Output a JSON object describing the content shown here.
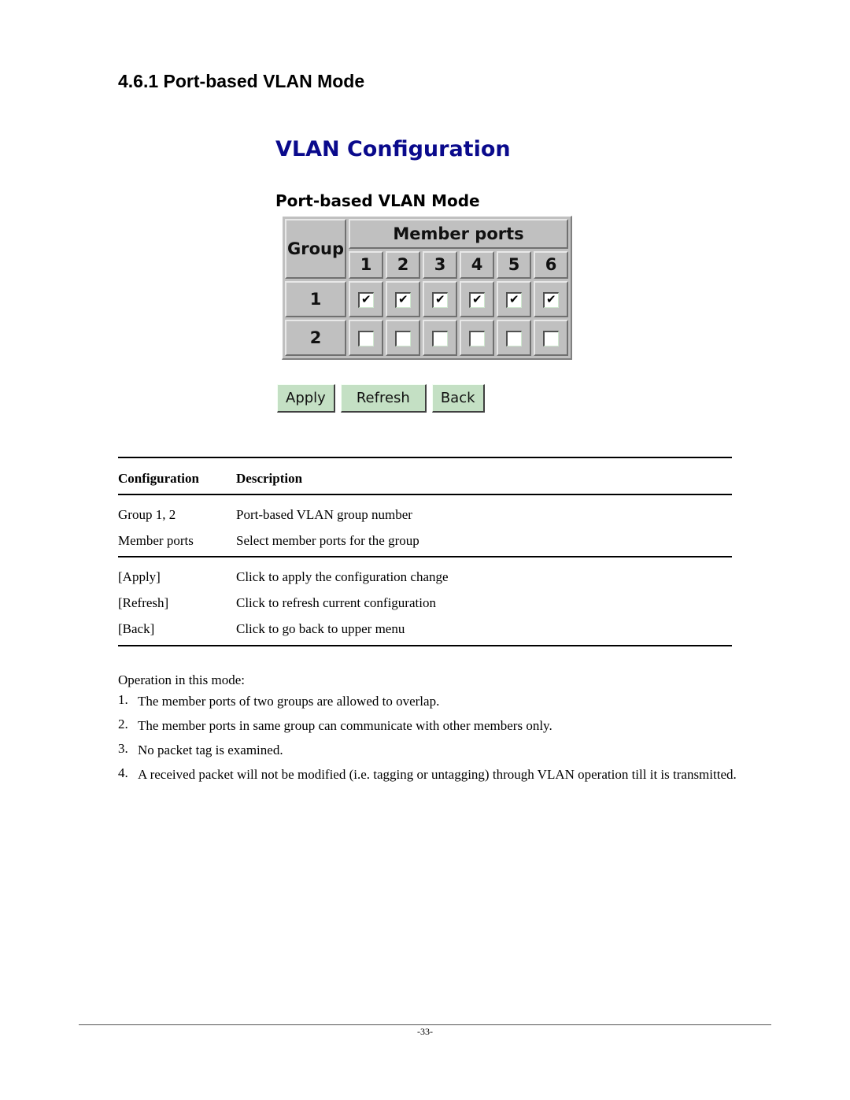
{
  "section": {
    "number": "4.6.1",
    "title": "4.6.1 Port-based VLAN Mode"
  },
  "screenshot": {
    "title": "VLAN Configuration",
    "subtitle": "Port-based VLAN Mode",
    "title_color": "#0a0a8c",
    "table": {
      "group_header": "Group",
      "member_header": "Member ports",
      "ports": [
        "1",
        "2",
        "3",
        "4",
        "5",
        "6"
      ],
      "groups": [
        {
          "label": "1",
          "members": [
            true,
            true,
            true,
            true,
            true,
            true
          ]
        },
        {
          "label": "2",
          "members": [
            false,
            false,
            false,
            false,
            false,
            false
          ]
        }
      ]
    },
    "buttons": {
      "apply": "Apply",
      "refresh": "Refresh",
      "back": "Back"
    },
    "button_color": "#c4e0c4"
  },
  "desc_table": {
    "headers": {
      "config": "Configuration",
      "description": "Description"
    },
    "rows": [
      {
        "config": "Group 1, 2",
        "description": "Port-based VLAN group number"
      },
      {
        "config": "Member ports",
        "description": "Select member ports for the group"
      },
      {
        "config": "[Apply]",
        "description": "Click to apply the configuration change"
      },
      {
        "config": "[Refresh]",
        "description": "Click to refresh current configuration"
      },
      {
        "config": "[Back]",
        "description": "Click to go back to upper menu"
      }
    ]
  },
  "operation": {
    "intro": "Operation in this mode:",
    "items": [
      {
        "num": "1.",
        "text": "The member ports of two groups are allowed to overlap."
      },
      {
        "num": "2.",
        "text": "The member ports in same group can communicate with other members only."
      },
      {
        "num": "3.",
        "text": "No packet tag is examined."
      },
      {
        "num": "4.",
        "text": "A received packet will not be modified (i.e. tagging or untagging) through VLAN operation till it is transmitted."
      }
    ]
  },
  "footer": {
    "page": "-33-"
  }
}
